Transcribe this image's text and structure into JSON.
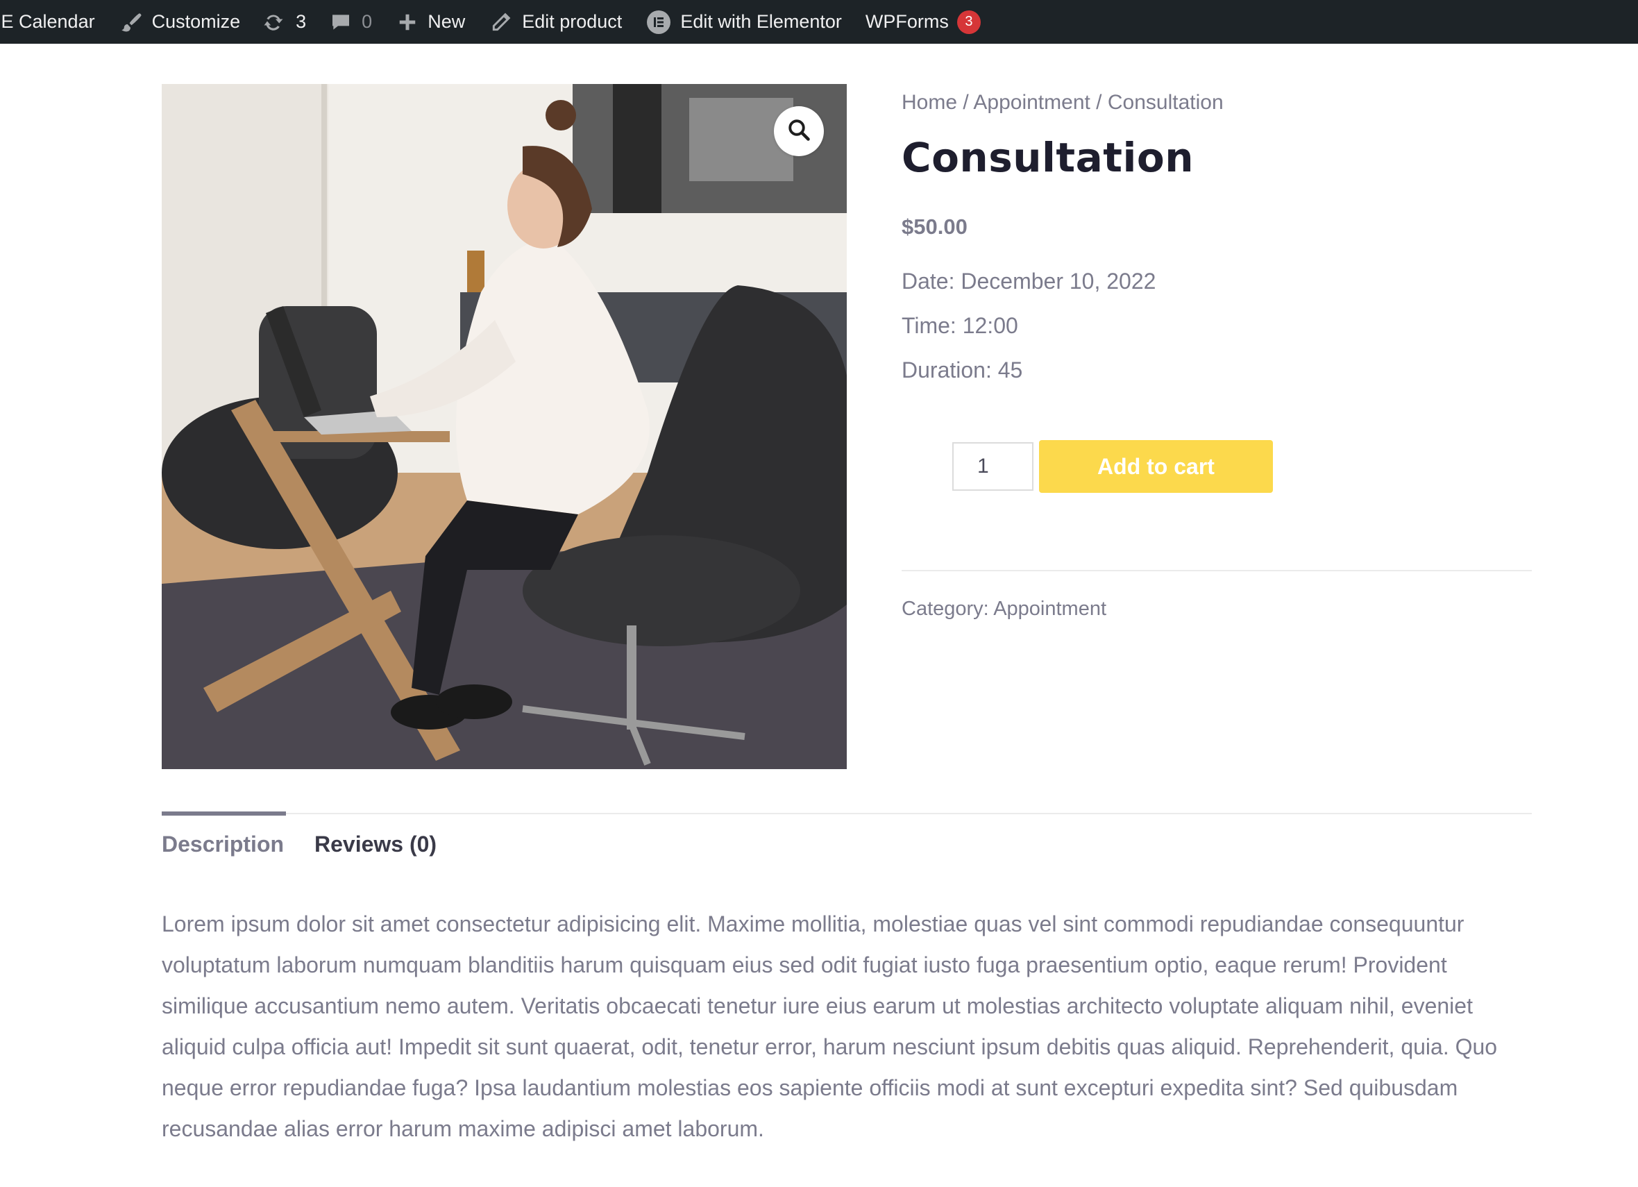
{
  "admin_bar": {
    "calendar_label": "IE Calendar",
    "customize_label": "Customize",
    "updates_count": "3",
    "comments_count": "0",
    "new_label": "New",
    "edit_product_label": "Edit product",
    "elementor_label": "Edit with Elementor",
    "wpforms_label": "WPForms",
    "wpforms_badge": "3",
    "badge_color": "#d63638"
  },
  "breadcrumb": {
    "home": "Home",
    "sep1": " / ",
    "category": "Appointment",
    "sep2": " / ",
    "current": "Consultation"
  },
  "product": {
    "title": "Consultation",
    "price": "$50.00",
    "date": "Date: December 10, 2022",
    "time": "Time: 12:00",
    "duration": "Duration: 45",
    "quantity": "1",
    "add_to_cart_label": "Add to cart",
    "add_to_cart_color": "#fcd94c",
    "category_label": "Category: ",
    "category_value": "Appointment",
    "image_icon": "zoom-search-icon"
  },
  "tabs": [
    {
      "label": "Description",
      "active": true
    },
    {
      "label": "Reviews (0)",
      "active": false
    }
  ],
  "description": {
    "text": "Lorem ipsum dolor sit amet consectetur adipisicing elit. Maxime mollitia, molestiae quas vel sint commodi repudiandae consequuntur voluptatum laborum numquam blanditiis harum quisquam eius sed odit fugiat iusto fuga praesentium optio, eaque rerum! Provident similique accusantium nemo autem. Veritatis obcaecati tenetur iure eius earum ut molestias architecto voluptate aliquam nihil, eveniet aliquid culpa officia aut! Impedit sit sunt quaerat, odit, tenetur error, harum nesciunt ipsum debitis quas aliquid. Reprehenderit, quia. Quo neque error repudiandae fuga? Ipsa laudantium molestias eos sapiente officiis modi at sunt excepturi expedita sint? Sed quibusdam recusandae alias error harum maxime adipisci amet laborum."
  }
}
